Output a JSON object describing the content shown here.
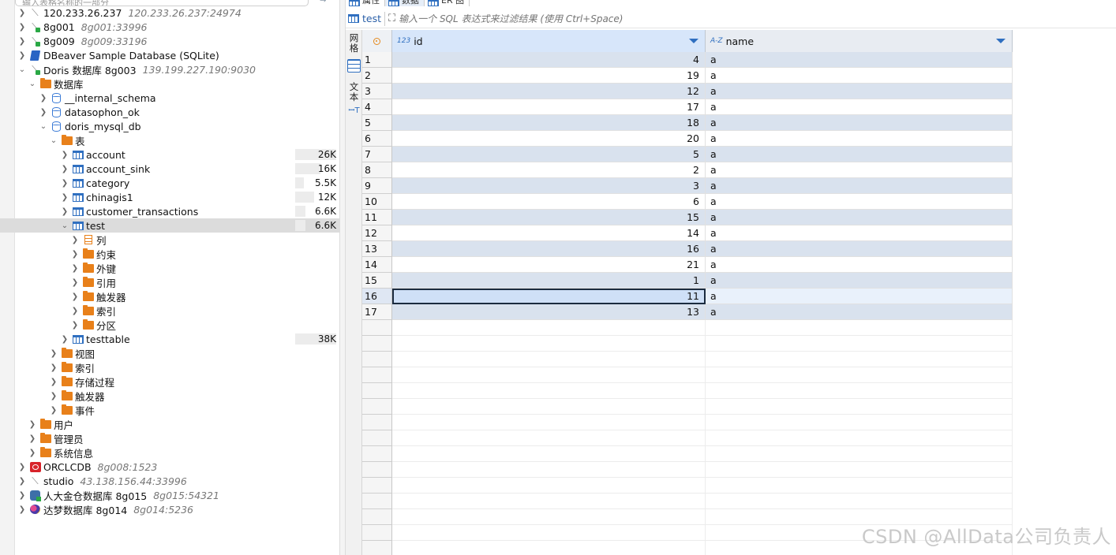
{
  "navigator": {
    "filter_placeholder": "输入表格名称的一部分",
    "connections_top": [
      {
        "name": "120.233.26.237",
        "meta": "120.233.26.237:24974",
        "icon": "connection-icon"
      },
      {
        "name": "8g001",
        "meta": "8g001:33996",
        "icon": "connection-icon"
      },
      {
        "name": "8g009",
        "meta": "8g009:33196",
        "icon": "connection-icon"
      },
      {
        "name": "DBeaver Sample Database (SQLite)",
        "meta": "",
        "icon": "sqlite-icon"
      }
    ],
    "doris": {
      "name": "Doris 数据库 8g003",
      "meta": "139.199.227.190:9030"
    },
    "databases_label": "数据库",
    "schemas": [
      "__internal_schema",
      "datasophon_ok",
      "doris_mysql_db"
    ],
    "tables_label": "表",
    "tables": [
      {
        "name": "account",
        "size": "26K",
        "fill": 1.0
      },
      {
        "name": "account_sink",
        "size": "16K",
        "fill": 0.62
      },
      {
        "name": "category",
        "size": "5.5K",
        "fill": 0.21
      },
      {
        "name": "chinagis1",
        "size": "12K",
        "fill": 0.46
      },
      {
        "name": "customer_transactions",
        "size": "6.6K",
        "fill": 0.25
      }
    ],
    "selected_table": {
      "name": "test",
      "size": "6.6K",
      "fill": 0.25
    },
    "test_children": [
      "列",
      "约束",
      "外键",
      "引用",
      "触发器",
      "索引",
      "分区"
    ],
    "testtable": {
      "name": "testtable",
      "size": "38K",
      "fill": 1.0
    },
    "db_children": [
      "视图",
      "索引",
      "存储过程",
      "触发器",
      "事件"
    ],
    "doris_children": [
      "用户",
      "管理员",
      "系统信息"
    ],
    "connections_bottom": [
      {
        "name": "ORCLCDB",
        "meta": "8g008:1523",
        "icon": "oracle-icon"
      },
      {
        "name": "studio",
        "meta": "43.138.156.44:33996",
        "icon": "connection-icon"
      },
      {
        "name": "人大金仓数据库 8g015",
        "meta": "8g015:54321",
        "icon": "kingbase-icon"
      },
      {
        "name": "达梦数据库 8g014",
        "meta": "8g014:5236",
        "icon": "dameng-icon"
      }
    ]
  },
  "editor": {
    "tabs": [
      "属性",
      "数据",
      "ER 图"
    ],
    "active_tab": "数据",
    "table_name": "test",
    "filter_placeholder": "输入一个 SQL 表达式来过滤结果 (使用 Ctrl+Space)",
    "side_tabs": {
      "grid": "网格",
      "text": "文本"
    },
    "columns": [
      {
        "name": "id",
        "type_icon": "123"
      },
      {
        "name": "name",
        "type_icon": "A-Z"
      }
    ],
    "rows": [
      {
        "n": "1",
        "id": "4",
        "name": "a"
      },
      {
        "n": "2",
        "id": "19",
        "name": "a"
      },
      {
        "n": "3",
        "id": "12",
        "name": "a"
      },
      {
        "n": "4",
        "id": "17",
        "name": "a"
      },
      {
        "n": "5",
        "id": "18",
        "name": "a"
      },
      {
        "n": "6",
        "id": "20",
        "name": "a"
      },
      {
        "n": "7",
        "id": "5",
        "name": "a"
      },
      {
        "n": "8",
        "id": "2",
        "name": "a"
      },
      {
        "n": "9",
        "id": "3",
        "name": "a"
      },
      {
        "n": "10",
        "id": "6",
        "name": "a"
      },
      {
        "n": "11",
        "id": "15",
        "name": "a"
      },
      {
        "n": "12",
        "id": "14",
        "name": "a"
      },
      {
        "n": "13",
        "id": "16",
        "name": "a"
      },
      {
        "n": "14",
        "id": "21",
        "name": "a"
      },
      {
        "n": "15",
        "id": "1",
        "name": "a"
      },
      {
        "n": "16",
        "id": "11",
        "name": "a"
      },
      {
        "n": "17",
        "id": "13",
        "name": "a"
      }
    ],
    "current_row": "16"
  },
  "watermark": "CSDN @AllData公司负责人"
}
